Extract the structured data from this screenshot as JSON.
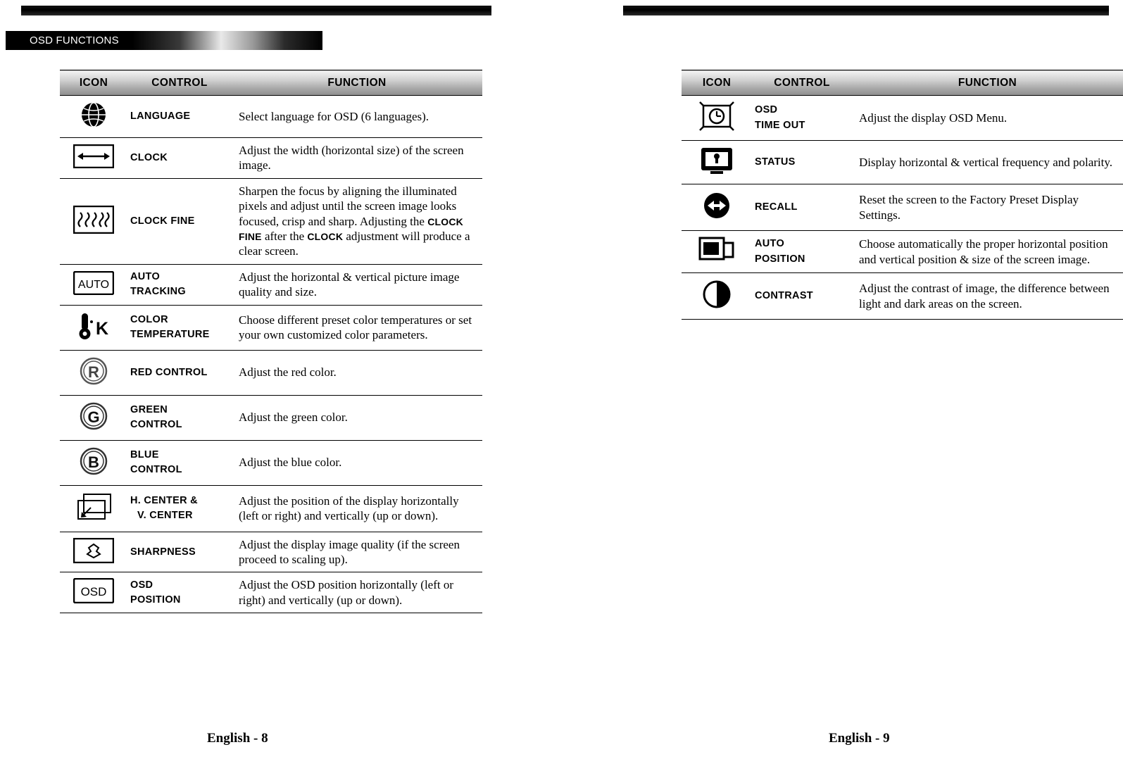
{
  "banner": {
    "title": "OSD FUNCTIONS"
  },
  "columns": {
    "icon": "ICON",
    "control": "CONTROL",
    "function": "FUNCTION"
  },
  "left_page": {
    "footer": "English - 8",
    "rows": [
      {
        "icon": "globe-icon",
        "control": "LANGUAGE",
        "function": "Select language for OSD (6 languages)."
      },
      {
        "icon": "horizontal-arrow-icon",
        "control": "CLOCK",
        "function": "Adjust the width (horizontal size) of the screen image."
      },
      {
        "icon": "clock-fine-pattern-icon",
        "control": "CLOCK FINE",
        "function_pre": "Sharpen the focus by aligning the illuminated pixels and adjust until the screen image looks focused, crisp and sharp.  Adjusting the ",
        "function_bold1": "CLOCK FINE",
        "function_mid": " after the ",
        "function_bold2": "CLOCK",
        "function_post": " adjustment will produce a clear screen."
      },
      {
        "icon": "auto-box-icon",
        "control": "AUTO\nTRACKING",
        "function": "Adjust the horizontal & vertical picture image quality and size."
      },
      {
        "icon": "thermometer-k-icon",
        "control": "COLOR\nTEMPERATURE",
        "function": "Choose different preset color temperatures or set your own customized color parameters."
      },
      {
        "icon": "circle-r-icon",
        "control": "RED CONTROL",
        "function": "Adjust the red color."
      },
      {
        "icon": "circle-g-icon",
        "control": "GREEN\nCONTROL",
        "function": "Adjust the green color."
      },
      {
        "icon": "circle-b-icon",
        "control": "BLUE\nCONTROL",
        "function": "Adjust the blue color."
      },
      {
        "icon": "center-position-icon",
        "control": "H. CENTER &",
        "control2": "V. CENTER",
        "function": "Adjust the position of the display horizontally (left or right) and vertically (up or down)."
      },
      {
        "icon": "sharpness-icon",
        "control": "SHARPNESS",
        "function": "Adjust the display image quality (if the screen proceed to scaling up)."
      },
      {
        "icon": "osd-box-icon",
        "control": "OSD\nPOSITION",
        "function": "Adjust the OSD position horizontally (left or right) and vertically (up or down)."
      }
    ]
  },
  "right_page": {
    "footer": "English - 9",
    "rows": [
      {
        "icon": "osd-timeout-clock-icon",
        "control": "OSD\nTIME OUT",
        "function": "Adjust the display OSD Menu."
      },
      {
        "icon": "status-monitor-icon",
        "control": "STATUS",
        "function": "Display horizontal & vertical frequency and polarity."
      },
      {
        "icon": "recall-arrows-icon",
        "control": "RECALL",
        "function": "Reset the screen to the Factory Preset Display Settings."
      },
      {
        "icon": "auto-position-icon",
        "control": "AUTO\nPOSITION",
        "function": "Choose automatically the proper horizontal position and vertical position & size of the screen image."
      },
      {
        "icon": "contrast-half-circle-icon",
        "control": "CONTRAST",
        "function": "Adjust the contrast of image, the difference between light and dark areas on the screen."
      }
    ]
  }
}
